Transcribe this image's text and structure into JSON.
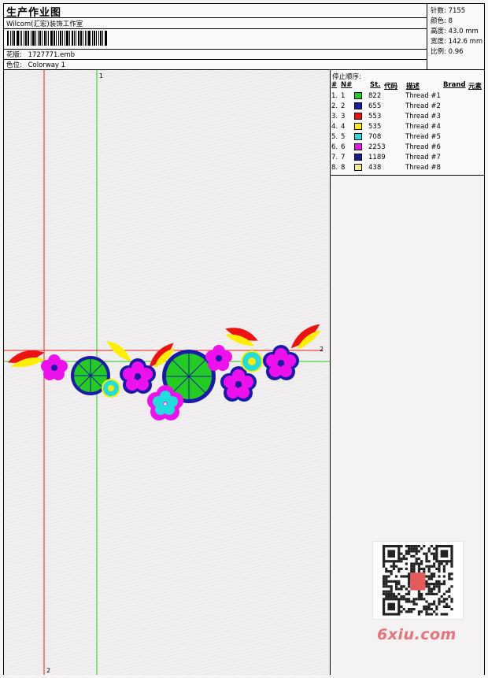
{
  "header": {
    "title": "生产作业图",
    "company": "Wilcom(汇宏)装饰工作室",
    "design_label": "花版:",
    "design_value": "1727771.emb",
    "colorway_label": "色位:",
    "colorway_value": "Colorway 1"
  },
  "stats": [
    {
      "label": "针数:",
      "value": "7155"
    },
    {
      "label": "颜色:",
      "value": "8"
    },
    {
      "label": "高度:",
      "value": "43.0 mm"
    },
    {
      "label": "宽度:",
      "value": "142.6 mm"
    },
    {
      "label": "比例:",
      "value": "0.96"
    }
  ],
  "stop_sequence": {
    "title": "停止顺序:",
    "headers": {
      "num": "#",
      "n": "N#",
      "st": "St.",
      "code": "代码",
      "desc": "描述",
      "brand": "Brand",
      "element": "元素"
    },
    "rows": [
      {
        "num": "1.",
        "n": "1",
        "color": "#22cc22",
        "st": "822",
        "desc": "Thread #1"
      },
      {
        "num": "2.",
        "n": "2",
        "color": "#1a1aa8",
        "st": "655",
        "desc": "Thread #2"
      },
      {
        "num": "3.",
        "n": "3",
        "color": "#ee1111",
        "st": "553",
        "desc": "Thread #3"
      },
      {
        "num": "4.",
        "n": "4",
        "color": "#ffee00",
        "st": "535",
        "desc": "Thread #4"
      },
      {
        "num": "5.",
        "n": "5",
        "color": "#22dddd",
        "st": "708",
        "desc": "Thread #5"
      },
      {
        "num": "6.",
        "n": "6",
        "color": "#ee11ee",
        "st": "2253",
        "desc": "Thread #6"
      },
      {
        "num": "7.",
        "n": "7",
        "color": "#1a1a99",
        "st": "1189",
        "desc": "Thread #7"
      },
      {
        "num": "8.",
        "n": "8",
        "color": "#f0ee88",
        "st": "438",
        "desc": "Thread #8"
      }
    ]
  },
  "guides": {
    "v_green": "1",
    "h_red": "2",
    "v_red": "2"
  },
  "watermark": {
    "logo": "6xiu.com"
  }
}
